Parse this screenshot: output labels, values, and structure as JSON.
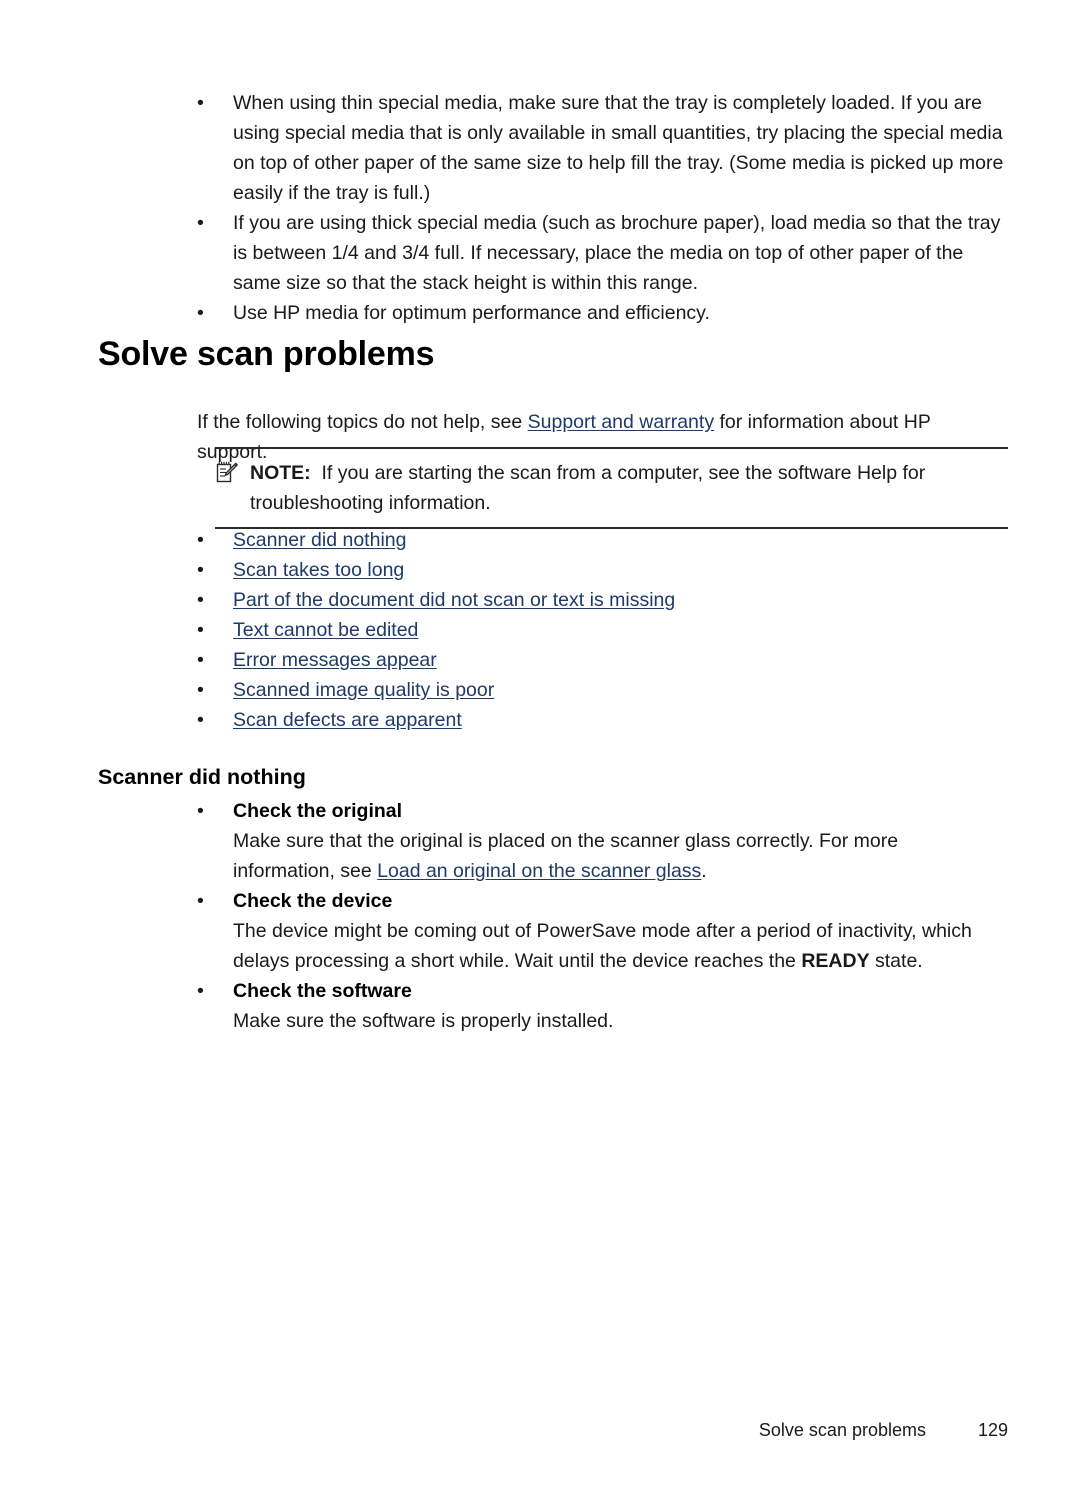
{
  "top_bullets": [
    {
      "bullet": "•",
      "text": "When using thin special media, make sure that the tray is completely loaded. If you are using special media that is only available in small quantities, try placing the special media on top of other paper of the same size to help fill the tray. (Some media is picked up more easily if the tray is full.)"
    },
    {
      "bullet": "•",
      "text": "If you are using thick special media (such as brochure paper), load media so that the tray is between 1/4 and 3/4 full. If necessary, place the media on top of other paper of the same size so that the stack height is within this range."
    },
    {
      "bullet": "•",
      "text": "Use HP media for optimum performance and efficiency."
    }
  ],
  "heading": "Solve scan problems",
  "intro": {
    "before_link": "If the following topics do not help, see ",
    "link": "Support and warranty",
    "after_link": " for information about HP support."
  },
  "note": {
    "icon": "note-pencil-icon",
    "label": "NOTE:",
    "text": "If you are starting the scan from a computer, see the software Help for troubleshooting information."
  },
  "topic_links": [
    {
      "bullet": "•",
      "label": "Scanner did nothing"
    },
    {
      "bullet": "•",
      "label": "Scan takes too long"
    },
    {
      "bullet": "•",
      "label": "Part of the document did not scan or text is missing"
    },
    {
      "bullet": "•",
      "label": "Text cannot be edited"
    },
    {
      "bullet": "•",
      "label": "Error messages appear"
    },
    {
      "bullet": "•",
      "label": "Scanned image quality is poor"
    },
    {
      "bullet": "•",
      "label": "Scan defects are apparent"
    }
  ],
  "subheading": "Scanner did nothing",
  "checks": [
    {
      "bullet": "•",
      "title": "Check the original",
      "body_before_link": "Make sure that the original is placed on the scanner glass correctly. For more information, see ",
      "body_link": "Load an original on the scanner glass",
      "body_after_link": "."
    },
    {
      "bullet": "•",
      "title": "Check the device",
      "body_before_strong": "The device might be coming out of PowerSave mode after a period of inactivity, which delays processing a short while. Wait until the device reaches the ",
      "body_strong": "READY",
      "body_after_strong": " state."
    },
    {
      "bullet": "•",
      "title": "Check the software",
      "body_plain": "Make sure the software is properly installed."
    }
  ],
  "footer": {
    "chapter": "Solve scan problems",
    "page_number": "129"
  },
  "colors": {
    "link": "#1f3a66",
    "text": "#1a1a1a",
    "rule": "#2b2b2b"
  }
}
